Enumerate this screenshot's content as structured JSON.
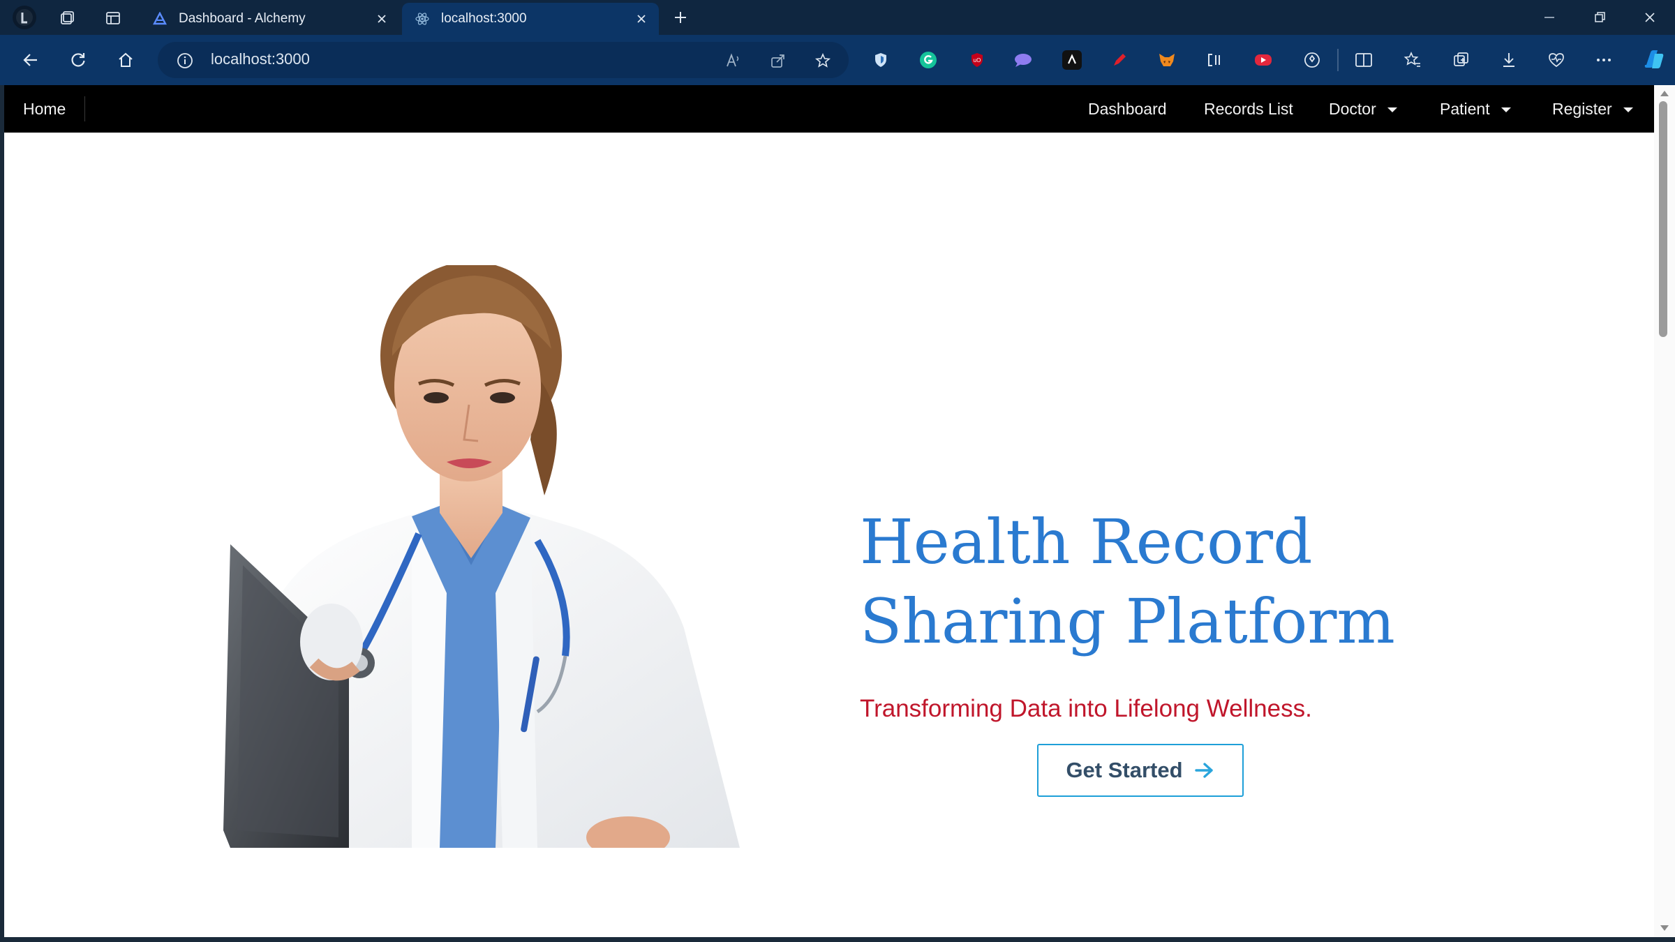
{
  "browser": {
    "tabs": [
      {
        "title": "Dashboard - Alchemy",
        "favicon": "alchemy-logo"
      },
      {
        "title": "localhost:3000",
        "favicon": "react-logo"
      }
    ],
    "address": "localhost:3000",
    "extensions": [
      "shield-icon",
      "grammarly-icon",
      "ublock-icon",
      "chat-icon",
      "cursor-icon",
      "pen-icon",
      "metamask-icon",
      "code-icon",
      "video-icon",
      "puzzle-icon"
    ],
    "colors": {
      "tabbar": "#0f2640",
      "toolbar": "#0c3566"
    }
  },
  "nav": {
    "home": "Home",
    "items": [
      {
        "label": "Dashboard"
      },
      {
        "label": "Records List"
      },
      {
        "label": "Doctor",
        "dropdown": true
      },
      {
        "label": "Patient",
        "dropdown": true
      },
      {
        "label": "Register",
        "dropdown": true
      }
    ]
  },
  "hero": {
    "title_line1": "Health Record",
    "title_line2": "Sharing Platform",
    "tagline": "Transforming Data into Lifelong Wellness.",
    "cta_label": "Get Started",
    "colors": {
      "title": "#2a7ad0",
      "tagline": "#c0162b",
      "cta_border": "#1e9fd8"
    }
  }
}
